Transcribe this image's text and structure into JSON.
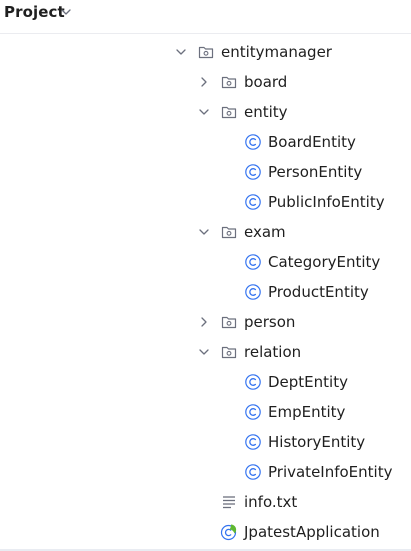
{
  "header": {
    "title": "Project",
    "dropdown_icon": "chevron-down-icon"
  },
  "tree": [
    {
      "label": "entitymanager",
      "type": "folder",
      "expanded": true,
      "depth": 0
    },
    {
      "label": "board",
      "type": "folder",
      "expanded": false,
      "depth": 1
    },
    {
      "label": "entity",
      "type": "folder",
      "expanded": true,
      "depth": 1
    },
    {
      "label": "BoardEntity",
      "type": "class",
      "depth": 2
    },
    {
      "label": "PersonEntity",
      "type": "class",
      "depth": 2
    },
    {
      "label": "PublicInfoEntity",
      "type": "class",
      "depth": 2
    },
    {
      "label": "exam",
      "type": "folder",
      "expanded": true,
      "depth": 1
    },
    {
      "label": "CategoryEntity",
      "type": "class",
      "depth": 2
    },
    {
      "label": "ProductEntity",
      "type": "class",
      "depth": 2
    },
    {
      "label": "person",
      "type": "folder",
      "expanded": false,
      "depth": 1
    },
    {
      "label": "relation",
      "type": "folder",
      "expanded": true,
      "depth": 1
    },
    {
      "label": "DeptEntity",
      "type": "class",
      "depth": 2
    },
    {
      "label": "EmpEntity",
      "type": "class",
      "depth": 2
    },
    {
      "label": "HistoryEntity",
      "type": "class",
      "depth": 2
    },
    {
      "label": "PrivateInfoEntity",
      "type": "class",
      "depth": 2
    },
    {
      "label": "info.txt",
      "type": "text-file",
      "depth": 1
    },
    {
      "label": "JpatestApplication",
      "type": "spring-app",
      "depth": 1
    }
  ],
  "colors": {
    "class_icon": "#3574f0",
    "spring_icon": "#5fb832",
    "icon_gray": "#6c707e"
  }
}
